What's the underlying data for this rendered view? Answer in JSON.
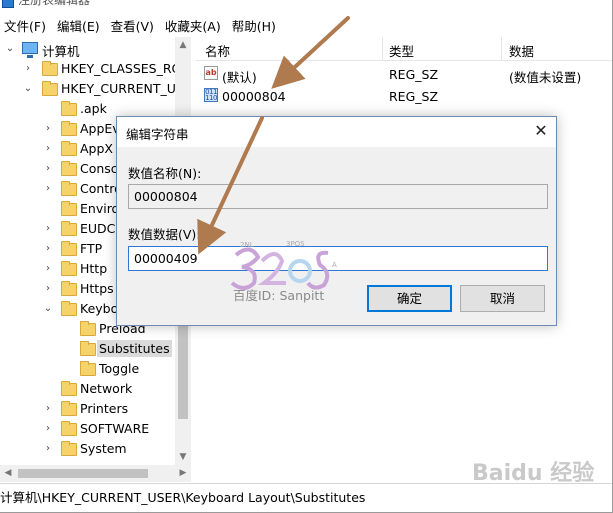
{
  "window": {
    "title_fragment": "注册表编辑器"
  },
  "menu": {
    "items": [
      "文件(F)",
      "编辑(E)",
      "查看(V)",
      "收藏夹(A)",
      "帮助(H)"
    ]
  },
  "tree": {
    "root": "计算机",
    "hkcr": "HKEY_CLASSES_ROO",
    "hkcu": "HKEY_CURRENT_US",
    "items": [
      ".apk",
      "AppEv",
      "AppX",
      "Consc",
      "Contro",
      "Enviro",
      "EUDC",
      "FTP",
      "Http",
      "Https",
      "Keybo"
    ],
    "preload": "Preload",
    "substitutes": "Substitutes",
    "toggle": "Toggle",
    "after": [
      "Network",
      "Printers",
      "SOFTWARE",
      "System"
    ]
  },
  "list": {
    "columns": [
      "名称",
      "类型",
      "数据"
    ],
    "rows": [
      {
        "name": "(默认)",
        "type": "REG_SZ",
        "data": "(数值未设置)",
        "icon": "string-value-icon"
      },
      {
        "name": "00000804",
        "type": "REG_SZ",
        "data": "",
        "icon": "binary-value-icon"
      }
    ]
  },
  "status": {
    "path": "计算机\\HKEY_CURRENT_USER\\Keyboard Layout\\Substitutes"
  },
  "dialog": {
    "title": "编辑字符串",
    "name_label": "数值名称(N):",
    "name_value": "00000804",
    "data_label": "数值数据(V):",
    "data_value": "00000409",
    "ok_label": "确定",
    "cancel_label": "取消"
  },
  "watermark": {
    "text": "百度ID: Sanpitt"
  },
  "baidu_watermark": "Baidu 经验",
  "colors": {
    "arrow": "#b07a4f",
    "accent": "#0078d7",
    "folder": "#f6d26b"
  }
}
